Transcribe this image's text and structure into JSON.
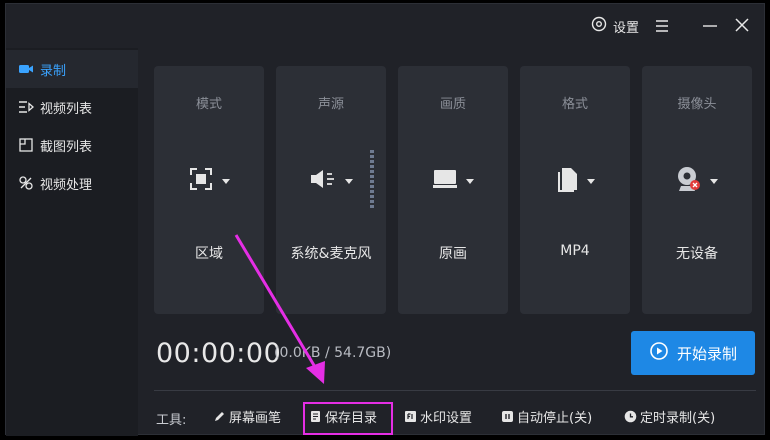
{
  "titlebar": {
    "settings_label": "设置"
  },
  "sidebar": {
    "items": [
      {
        "label": "录制",
        "icon": "camera-icon",
        "active": true
      },
      {
        "label": "视频列表",
        "icon": "video-list-icon",
        "active": false
      },
      {
        "label": "截图列表",
        "icon": "screenshot-list-icon",
        "active": false
      },
      {
        "label": "视频处理",
        "icon": "video-process-icon",
        "active": false
      }
    ]
  },
  "cards": [
    {
      "title": "模式",
      "value": "区域",
      "icon": "region-select-icon"
    },
    {
      "title": "声源",
      "value": "系统&麦克风",
      "icon": "speaker-icon"
    },
    {
      "title": "画质",
      "value": "原画",
      "icon": "monitor-icon"
    },
    {
      "title": "格式",
      "value": "MP4",
      "icon": "file-icon"
    },
    {
      "title": "摄像头",
      "value": "无设备",
      "icon": "webcam-icon"
    }
  ],
  "status": {
    "timer": "00:00:00",
    "size": "(0.0KB / 54.7GB)"
  },
  "start_button": {
    "label": "开始录制"
  },
  "tools": {
    "label": "工具:",
    "items": [
      {
        "label": "屏幕画笔",
        "icon": "pen-icon"
      },
      {
        "label": "保存目录",
        "icon": "folder-doc-icon"
      },
      {
        "label": "水印设置",
        "icon": "watermark-icon"
      },
      {
        "label": "自动停止(关)",
        "icon": "pause-icon"
      },
      {
        "label": "定时录制(关)",
        "icon": "clock-icon"
      }
    ]
  },
  "colors": {
    "accent": "#1e88e5",
    "active_text": "#3aa3ff",
    "highlight": "#e52ee5"
  }
}
